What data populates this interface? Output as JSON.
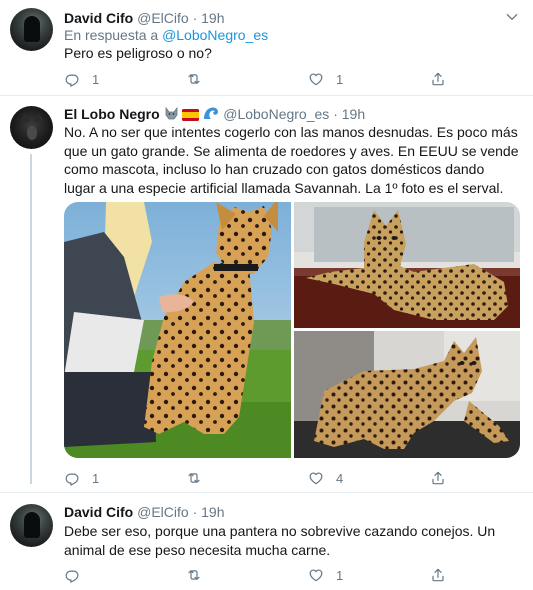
{
  "tweets": [
    {
      "name": "David Cifo",
      "handle": "@ElCifo",
      "separator": "·",
      "time": "19h",
      "reply_prefix": "En respuesta a ",
      "reply_mention": "@LoboNegro_es",
      "text": "Pero es peligroso o no?",
      "reply_count": "1",
      "retweet_count": "",
      "like_count": "1"
    },
    {
      "name": "El Lobo Negro",
      "name_emoji": [
        "wolf-emoji",
        "spain-flag-emoji",
        "wave-emoji"
      ],
      "handle": "@LoboNegro_es",
      "separator": "·",
      "time": "19h",
      "text": "No. A no ser que intentes cogerlo con las manos desnudas. Es poco más que un gato grande. Se alimenta de roedores y  aves. En EEUU se vende como mascota, incluso lo han cruzado con gatos domésticos dando lugar a una especie artificial llamada Savannah. La 1º foto es el serval.",
      "reply_count": "1",
      "retweet_count": "",
      "like_count": "4",
      "photos": [
        "serval-with-person-photo",
        "savannah-cat-lying-photo",
        "savannah-cat-reclining-photo"
      ]
    },
    {
      "name": "David Cifo",
      "handle": "@ElCifo",
      "separator": "·",
      "time": "19h",
      "text": "Debe ser eso, porque una pantera no sobrevive cazando conejos. Un animal de ese peso necesita mucha carne.",
      "reply_count": "",
      "retweet_count": "",
      "like_count": "1"
    }
  ],
  "colors": {
    "text": "#14171a",
    "secondary": "#657786",
    "link": "#1b95e0",
    "thread_line": "#ccd6dd",
    "border": "#e6ecf0"
  },
  "icons": [
    "chevron-down-icon",
    "reply-icon",
    "retweet-icon",
    "like-icon",
    "share-icon"
  ]
}
